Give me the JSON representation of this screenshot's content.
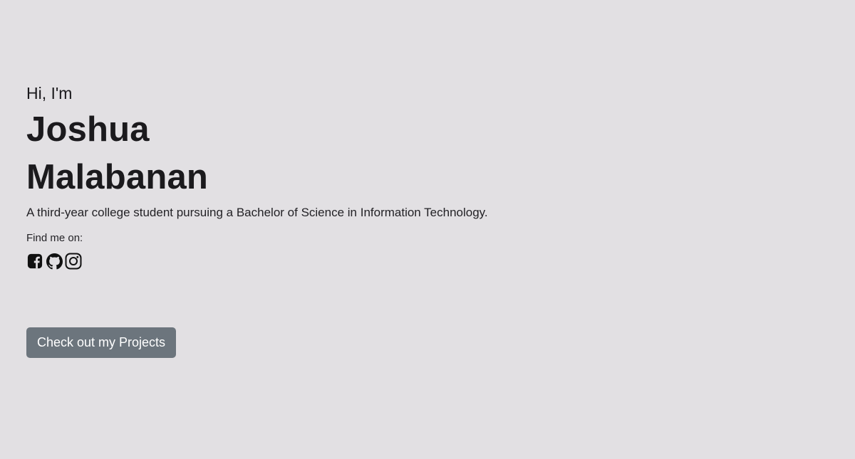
{
  "hero": {
    "greeting": "Hi, I'm",
    "name_first": "Joshua",
    "name_last": "Malabanan",
    "tagline": "A third-year college student pursuing a Bachelor of Science in Information Technology.",
    "find_label": "Find me on:",
    "socials": [
      {
        "icon": "facebook-icon"
      },
      {
        "icon": "github-icon"
      },
      {
        "icon": "instagram-icon"
      }
    ],
    "cta_label": "Check out my Projects"
  },
  "colors": {
    "background": "#e2e0e3",
    "text": "#1b1a1d",
    "button": "#6c757d",
    "button_text": "#ffffff"
  }
}
